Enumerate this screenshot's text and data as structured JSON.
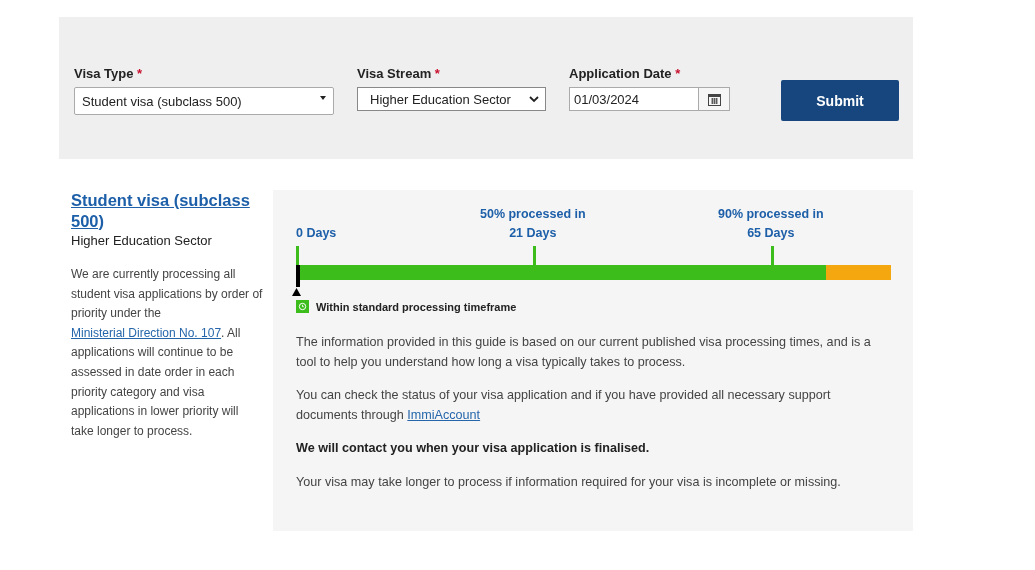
{
  "form": {
    "fields": [
      {
        "kind": "select",
        "label": "Visa Type",
        "required_mark": "*",
        "value": "Student visa (subclass 500)"
      },
      {
        "kind": "native-select",
        "label": "Visa Stream",
        "required_mark": "*",
        "value": "Higher Education Sector"
      },
      {
        "kind": "date",
        "label": "Application Date",
        "required_mark": "*",
        "value": "01/03/2024"
      }
    ],
    "submit": "Submit"
  },
  "summary": {
    "title": "Student visa (subclass 500)",
    "subtitle": "Higher Education Sector",
    "paragraph": {
      "before": "We are currently processing all student visa applications by order of priority under the",
      "link": "Ministerial Direction No. 107",
      "after": ". All applications will continue to be assessed in date order in each priority category and visa applications in lower priority will take longer to process."
    }
  },
  "timeline": {
    "markers": [
      {
        "lines": [
          "0 Days"
        ]
      },
      {
        "lines": [
          "50% processed in",
          "21 Days"
        ]
      },
      {
        "lines": [
          "90% processed in",
          "65 Days"
        ]
      }
    ],
    "fill": {
      "level": 0.89
    },
    "pointer": {
      "level": 0
    },
    "legend": "Within standard processing timeframe"
  },
  "info": [
    {
      "kind": "text",
      "text": "The information provided in this guide is based on our current published visa processing times, and is a tool to help you understand how long a visa typically takes to process."
    },
    {
      "kind": "link",
      "text": "You can check the status of your visa application and if you have provided all necessary support documents through",
      "link": "ImmiAccount"
    },
    {
      "kind": "bold",
      "text": "We will contact you when your visa application is finalised."
    },
    {
      "kind": "text",
      "text": "Your visa may take longer to process if information required for your visa is incomplete or missing."
    }
  ]
}
